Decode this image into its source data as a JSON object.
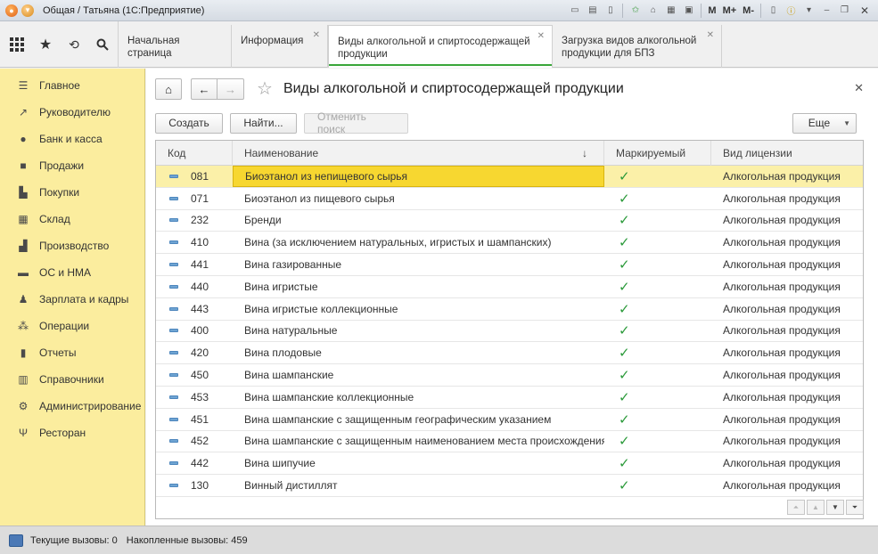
{
  "window": {
    "title": "Общая / Татьяна  (1С:Предприятие)",
    "toolbar_text_buttons": [
      "M",
      "M+",
      "M-"
    ]
  },
  "tabs": [
    {
      "label": "Начальная страница",
      "active": false,
      "closable": false
    },
    {
      "label": "Информация",
      "active": false,
      "closable": true
    },
    {
      "label": "Виды алкогольной и спиртосодержащей продукции",
      "active": true,
      "closable": true
    },
    {
      "label": "Загрузка видов алкогольной продукции для БПЗ",
      "active": false,
      "closable": true
    }
  ],
  "sidebar": {
    "items": [
      {
        "label": "Главное",
        "icon": "menu-icon"
      },
      {
        "label": "Руководителю",
        "icon": "trend-icon"
      },
      {
        "label": "Банк и касса",
        "icon": "coin-icon"
      },
      {
        "label": "Продажи",
        "icon": "bag-icon"
      },
      {
        "label": "Покупки",
        "icon": "cart-icon"
      },
      {
        "label": "Склад",
        "icon": "warehouse-icon"
      },
      {
        "label": "Производство",
        "icon": "factory-icon"
      },
      {
        "label": "ОС и НМА",
        "icon": "truck-icon"
      },
      {
        "label": "Зарплата и кадры",
        "icon": "person-icon"
      },
      {
        "label": "Операции",
        "icon": "operations-icon"
      },
      {
        "label": "Отчеты",
        "icon": "chart-icon"
      },
      {
        "label": "Справочники",
        "icon": "book-icon"
      },
      {
        "label": "Администрирование",
        "icon": "gear-icon"
      },
      {
        "label": "Ресторан",
        "icon": "cutlery-icon"
      }
    ]
  },
  "form": {
    "title": "Виды алкогольной и спиртосодержащей продукции",
    "create_label": "Создать",
    "find_label": "Найти...",
    "cancel_search_label": "Отменить поиск",
    "more_label": "Еще"
  },
  "table": {
    "columns": [
      "Код",
      "Наименование",
      "Маркируемый",
      "Вид лицензии"
    ],
    "rows": [
      {
        "code": "081",
        "name": "Биоэтанол из непищевого сырья",
        "marked": "✓",
        "license": "Алкогольная продукция"
      },
      {
        "code": "071",
        "name": "Биоэтанол из пищевого сырья",
        "marked": "✓",
        "license": "Алкогольная продукция"
      },
      {
        "code": "232",
        "name": "Бренди",
        "marked": "✓",
        "license": "Алкогольная продукция"
      },
      {
        "code": "410",
        "name": "Вина (за исключением натуральных, игристых и шампанских)",
        "marked": "✓",
        "license": "Алкогольная продукция"
      },
      {
        "code": "441",
        "name": "Вина газированные",
        "marked": "✓",
        "license": "Алкогольная продукция"
      },
      {
        "code": "440",
        "name": "Вина игристые",
        "marked": "✓",
        "license": "Алкогольная продукция"
      },
      {
        "code": "443",
        "name": "Вина игристые коллекционные",
        "marked": "✓",
        "license": "Алкогольная продукция"
      },
      {
        "code": "400",
        "name": "Вина натуральные",
        "marked": "✓",
        "license": "Алкогольная продукция"
      },
      {
        "code": "420",
        "name": "Вина плодовые",
        "marked": "✓",
        "license": "Алкогольная продукция"
      },
      {
        "code": "450",
        "name": "Вина шампанские",
        "marked": "✓",
        "license": "Алкогольная продукция"
      },
      {
        "code": "453",
        "name": "Вина шампанские коллекционные",
        "marked": "✓",
        "license": "Алкогольная продукция"
      },
      {
        "code": "451",
        "name": "Вина шампанские с защищенным географическим указанием",
        "marked": "✓",
        "license": "Алкогольная продукция"
      },
      {
        "code": "452",
        "name": "Вина шампанские с защищенным наименованием места происхождения",
        "marked": "✓",
        "license": "Алкогольная продукция"
      },
      {
        "code": "442",
        "name": "Вина шипучие",
        "marked": "✓",
        "license": "Алкогольная продукция"
      },
      {
        "code": "130",
        "name": "Винный дистиллят",
        "marked": "✓",
        "license": "Алкогольная продукция"
      }
    ],
    "selected_row": 0
  },
  "status": {
    "current_calls": "Текущие вызовы: 0",
    "accumulated_calls": "Накопленные вызовы: 459"
  },
  "colors": {
    "sidebar_bg": "#fbed9e",
    "selected_row": "#fbf0a8",
    "selected_cell": "#f7d730",
    "check": "#2b9a3a",
    "active_tab_underline": "#3aa63a"
  }
}
